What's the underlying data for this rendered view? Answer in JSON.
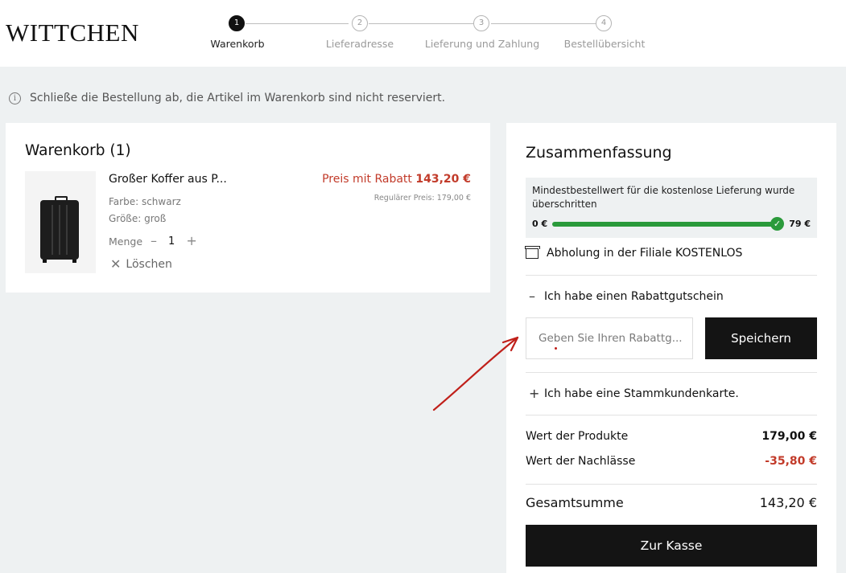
{
  "header": {
    "logo": "WITTCHEN",
    "steps": [
      {
        "number": "1",
        "label": "Warenkorb",
        "active": true
      },
      {
        "number": "2",
        "label": "Lieferadresse",
        "active": false
      },
      {
        "number": "3",
        "label": "Lieferung und Zahlung",
        "active": false
      },
      {
        "number": "4",
        "label": "Bestellübersicht",
        "active": false
      }
    ]
  },
  "info": {
    "icon": "info-icon",
    "text": "Schließe die Bestellung ab, die Artikel im Warenkorb sind nicht reserviert."
  },
  "cart": {
    "title": "Warenkorb (1)",
    "item": {
      "name": "Großer Koffer aus P...",
      "color": "Farbe: schwarz",
      "size": "Größe: groß",
      "quantity_label": "Menge",
      "quantity_minus": "–",
      "quantity": "1",
      "quantity_plus": "+",
      "delete_label": "Löschen",
      "discount_price_label": "Preis mit Rabatt",
      "discount_price": "143,20 €",
      "regular_price": "Regulärer Preis: 179,00 €"
    }
  },
  "summary": {
    "title": "Zusammenfassung",
    "free_shipping": {
      "text": "Mindestbestellwert für die kostenlose Lieferung wurde überschritten",
      "min": "0 €",
      "max": "79 €",
      "progress": 1.0,
      "check": "✓"
    },
    "pickup": "Abholung in der Filiale KOSTENLOS",
    "coupon": {
      "toggle_symbol": "–",
      "toggle_label": "Ich habe einen Rabattgutschein",
      "placeholder": "Geben Sie Ihren Rabattg...",
      "save_label": "Speichern"
    },
    "loyalty": {
      "toggle_symbol": "+",
      "toggle_label": "Ich habe eine Stammkundenkarte."
    },
    "products_value_label": "Wert der Produkte",
    "products_value": "179,00 €",
    "discounts_label": "Wert der Nachlässe",
    "discounts_value": "-35,80 €",
    "total_label": "Gesamtsumme",
    "total_value": "143,20 €",
    "checkout_label": "Zur Kasse"
  },
  "colors": {
    "accent_red": "#c23b2a",
    "progress_green": "#2a9a3b",
    "button_black": "#141414",
    "annotation_red": "#c0201a"
  }
}
